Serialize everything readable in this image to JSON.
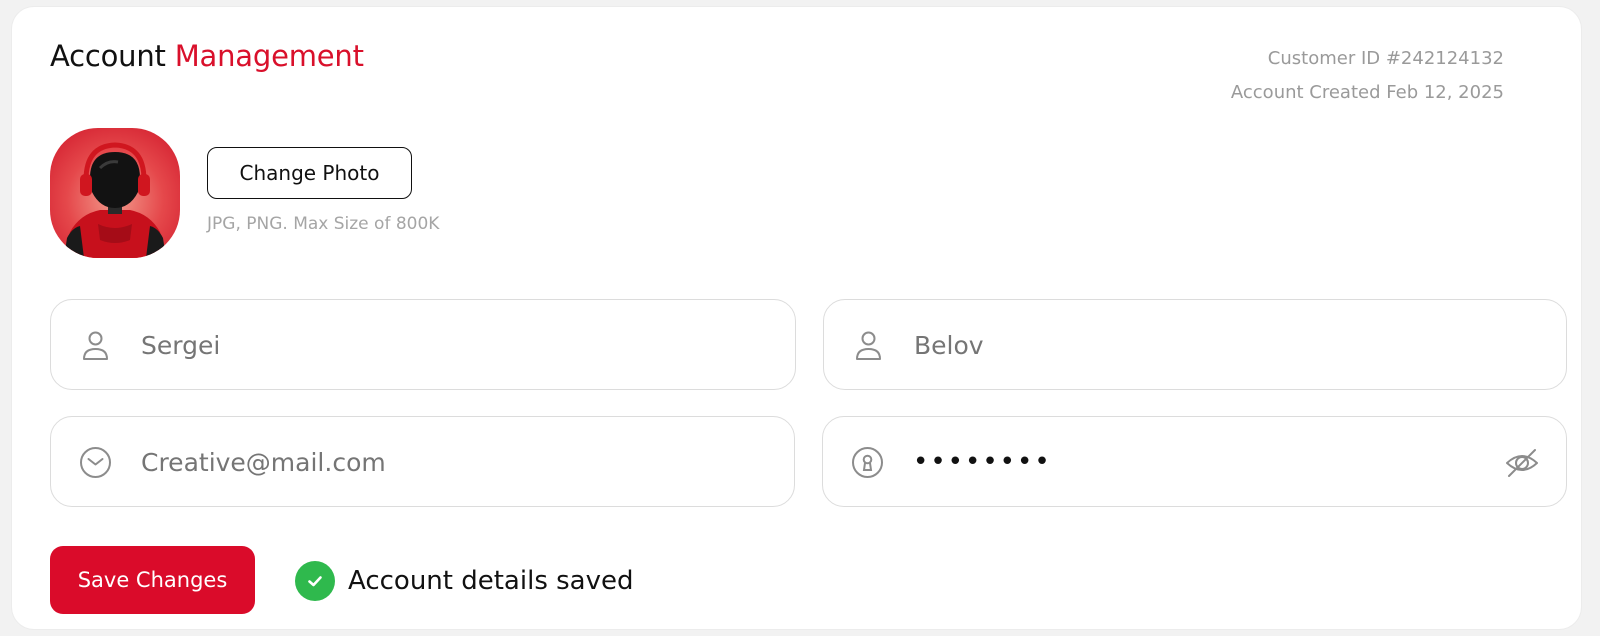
{
  "header": {
    "title_plain": "Account",
    "title_accent": "Management",
    "customer_id": "Customer ID #242124132",
    "account_created": "Account Created Feb 12, 2025"
  },
  "profile": {
    "avatar": "robot-avatar",
    "change_photo_label": "Change Photo",
    "photo_hint": "JPG, PNG. Max Size of 800K"
  },
  "form": {
    "first_name": {
      "placeholder": "Sergei",
      "icon": "user-icon"
    },
    "last_name": {
      "placeholder": "Belov",
      "icon": "user-icon"
    },
    "email": {
      "placeholder": "Creative@mail.com",
      "icon": "mail-icon"
    },
    "password": {
      "value": "••••••••",
      "icon": "lock-icon",
      "toggle_icon": "eye-off-icon"
    }
  },
  "actions": {
    "save_label": "Save Changes",
    "status_text": "Account details saved",
    "status_icon": "check-icon"
  },
  "colors": {
    "accent": "#d9102b",
    "success": "#2fb94d",
    "muted_text": "#9a9a9a",
    "border": "#dcdcdc"
  }
}
